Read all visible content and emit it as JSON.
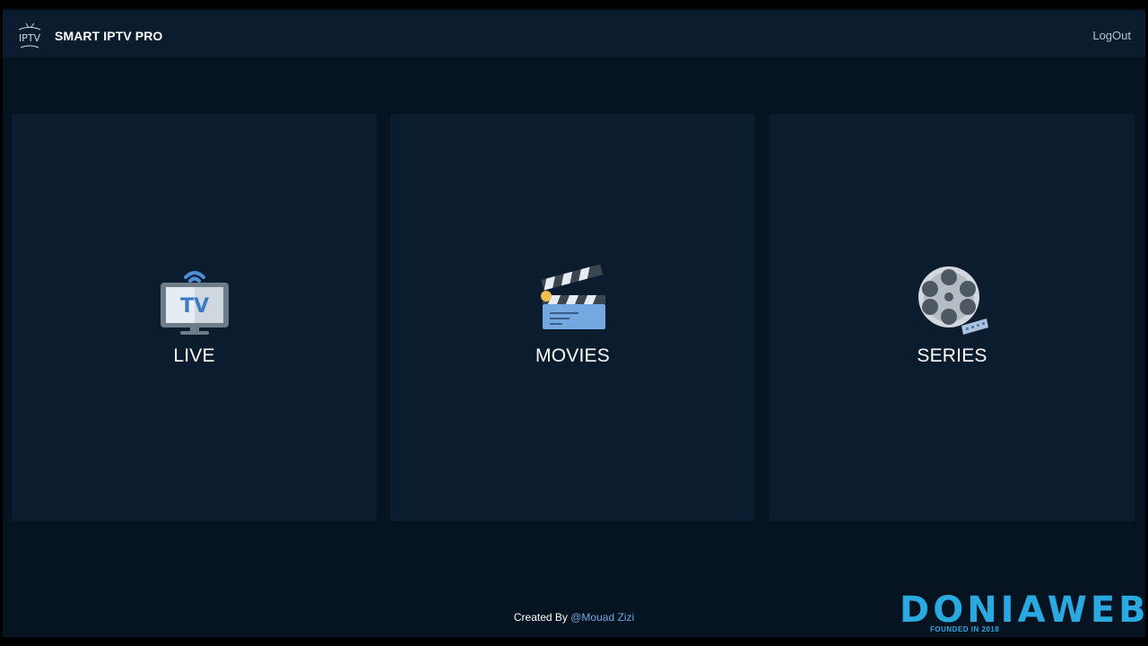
{
  "header": {
    "logo_text": "IPTV",
    "brand": "SMART IPTV PRO",
    "logout_label": "LogOut"
  },
  "cards": [
    {
      "label": "LIVE",
      "icon": "tv-icon"
    },
    {
      "label": "MOVIES",
      "icon": "clapperboard-icon"
    },
    {
      "label": "SERIES",
      "icon": "film-reel-icon"
    }
  ],
  "footer": {
    "created_by": "Created By",
    "author": "@Mouad Zizi"
  },
  "watermark": {
    "brand": "DONIAWEB",
    "tagline": "FOUNDED IN 2018"
  },
  "colors": {
    "background": "#061321",
    "panel": "#0c1c2f",
    "accent": "#6ea8dc",
    "watermark": "#29a9e0"
  }
}
